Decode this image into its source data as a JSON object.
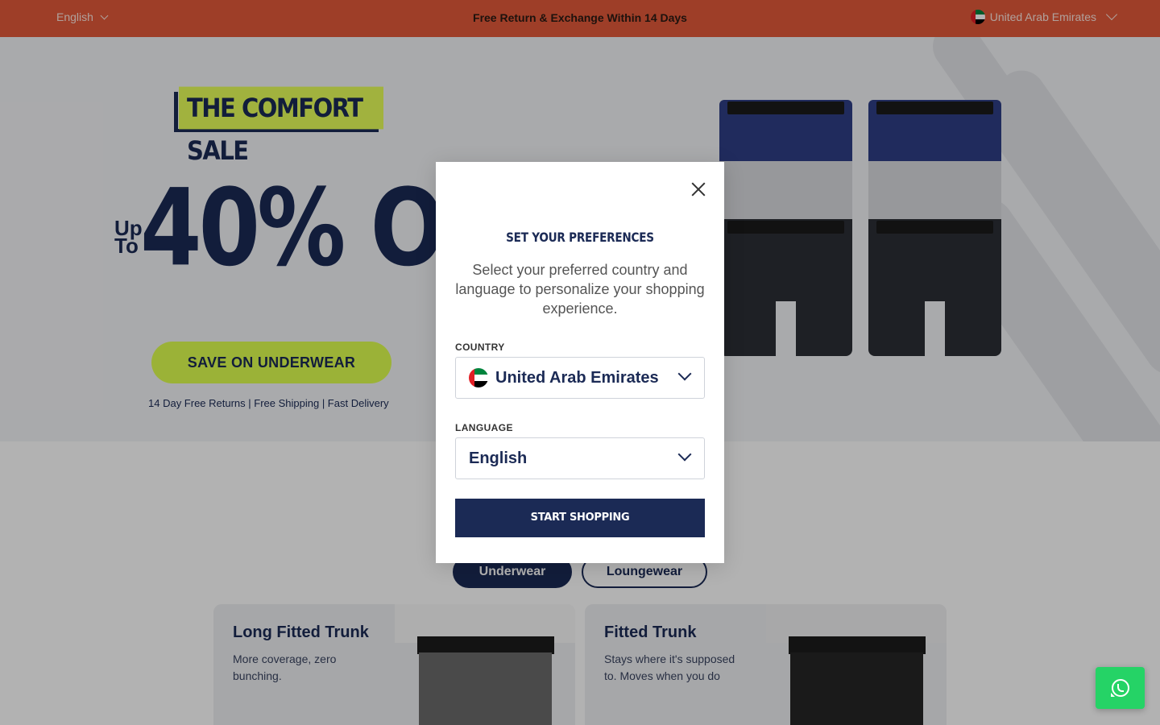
{
  "topbar": {
    "language": "English",
    "promo": "Free Return & Exchange Within 14 Days",
    "country": "United Arab Emirates"
  },
  "hero": {
    "tag": "THE COMFORT SALE",
    "upto_line1": "Up",
    "upto_line2": "To",
    "discount": "40% OFF",
    "cta": "SAVE ON UNDERWEAR",
    "perks": "14 Day Free Returns | Free Shipping | Fast Delivery"
  },
  "categories": [
    {
      "label": "Underwear",
      "active": true
    },
    {
      "label": "Loungewear",
      "active": false
    }
  ],
  "cards": [
    {
      "title": "Long Fitted Trunk",
      "desc": "More coverage, zero bunching."
    },
    {
      "title": "Fitted Trunk",
      "desc": "Stays where it's supposed to. Moves when you do"
    }
  ],
  "modal": {
    "title": "SET YOUR PREFERENCES",
    "description": "Select your preferred country and language to personalize your shopping experience.",
    "country_label": "COUNTRY",
    "country_value": "United Arab Emirates",
    "language_label": "LANGUAGE",
    "language_value": "English",
    "submit": "START SHOPPING"
  },
  "icons": {
    "close": "close-icon",
    "chevron": "chevron-down-icon",
    "flag": "uae-flag-icon",
    "whatsapp": "whatsapp-icon"
  },
  "colors": {
    "topbar": "#e35a3a",
    "navy": "#1b2a55",
    "lime": "#dfff4f",
    "whatsapp": "#25d366"
  }
}
